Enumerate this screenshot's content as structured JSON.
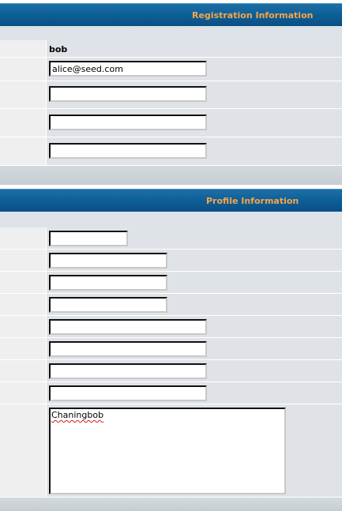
{
  "registration": {
    "header_title": "Registration Information",
    "username_value": "bob",
    "email_value": "alice@seed.com",
    "field3_value": "",
    "field4_value": "",
    "field5_value": ""
  },
  "profile": {
    "header_title": "Profile Information",
    "field1_value": "",
    "field2_value": "",
    "field3_value": "",
    "field4_value": "",
    "field5_value": "",
    "field6_value": "",
    "field7_value": "",
    "field8_value": "",
    "signature_value": "Chaningbob"
  },
  "colors": {
    "header_bg": "#0d5f97",
    "header_text": "#f7a54a",
    "label_cell_bg": "#efefef",
    "field_cell_bg": "#dfe3e7"
  }
}
